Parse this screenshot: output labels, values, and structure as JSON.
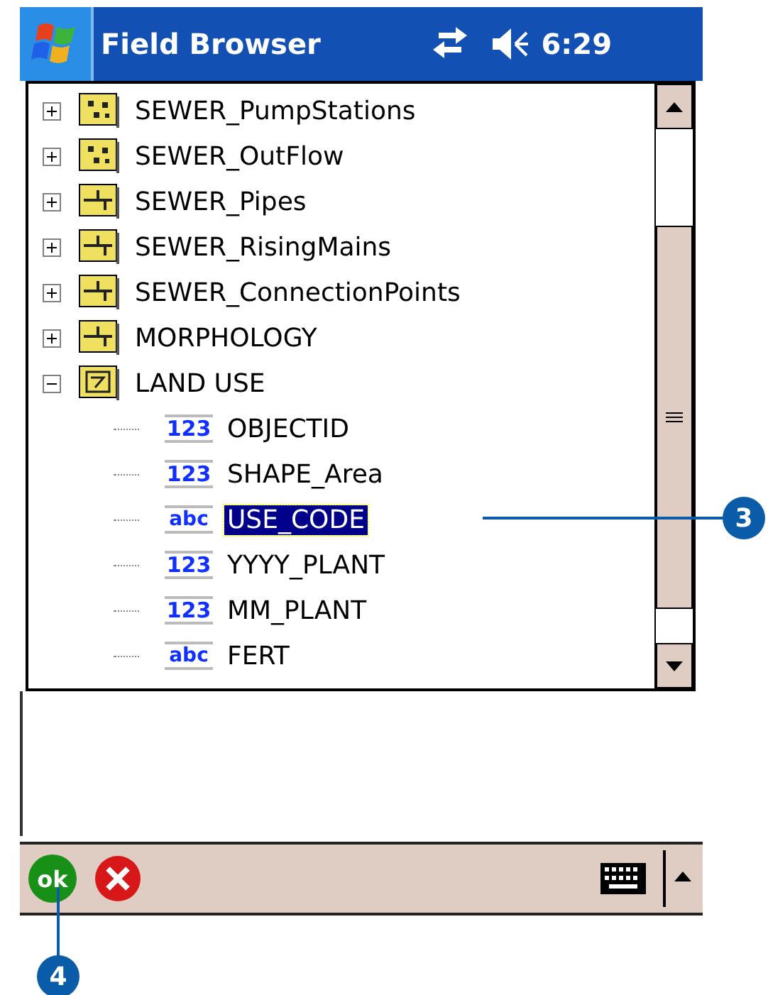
{
  "title_bar": {
    "title": "Field Browser",
    "time": "6:29"
  },
  "tree": [
    {
      "label": "SEWER_PumpStations",
      "kind": "point",
      "expanded": false,
      "selected": false
    },
    {
      "label": "SEWER_OutFlow",
      "kind": "point",
      "expanded": false,
      "selected": false
    },
    {
      "label": "SEWER_Pipes",
      "kind": "line",
      "expanded": false,
      "selected": false
    },
    {
      "label": "SEWER_RisingMains",
      "kind": "line",
      "expanded": false,
      "selected": false
    },
    {
      "label": "SEWER_ConnectionPoints",
      "kind": "line",
      "expanded": false,
      "selected": false
    },
    {
      "label": "MORPHOLOGY",
      "kind": "line",
      "expanded": false,
      "selected": false
    },
    {
      "label": "LAND USE",
      "kind": "polygon",
      "expanded": true,
      "selected": false,
      "children": [
        {
          "label": "OBJECTID",
          "type": "123",
          "selected": false
        },
        {
          "label": "SHAPE_Area",
          "type": "123",
          "selected": false
        },
        {
          "label": "USE_CODE",
          "type": "abc",
          "selected": true
        },
        {
          "label": "YYYY_PLANT",
          "type": "123",
          "selected": false
        },
        {
          "label": "MM_PLANT",
          "type": "123",
          "selected": false
        },
        {
          "label": "FERT",
          "type": "abc",
          "selected": false
        }
      ]
    }
  ],
  "toolbar": {
    "ok": "ok"
  },
  "callouts": [
    {
      "number": "3"
    },
    {
      "number": "4"
    }
  ]
}
